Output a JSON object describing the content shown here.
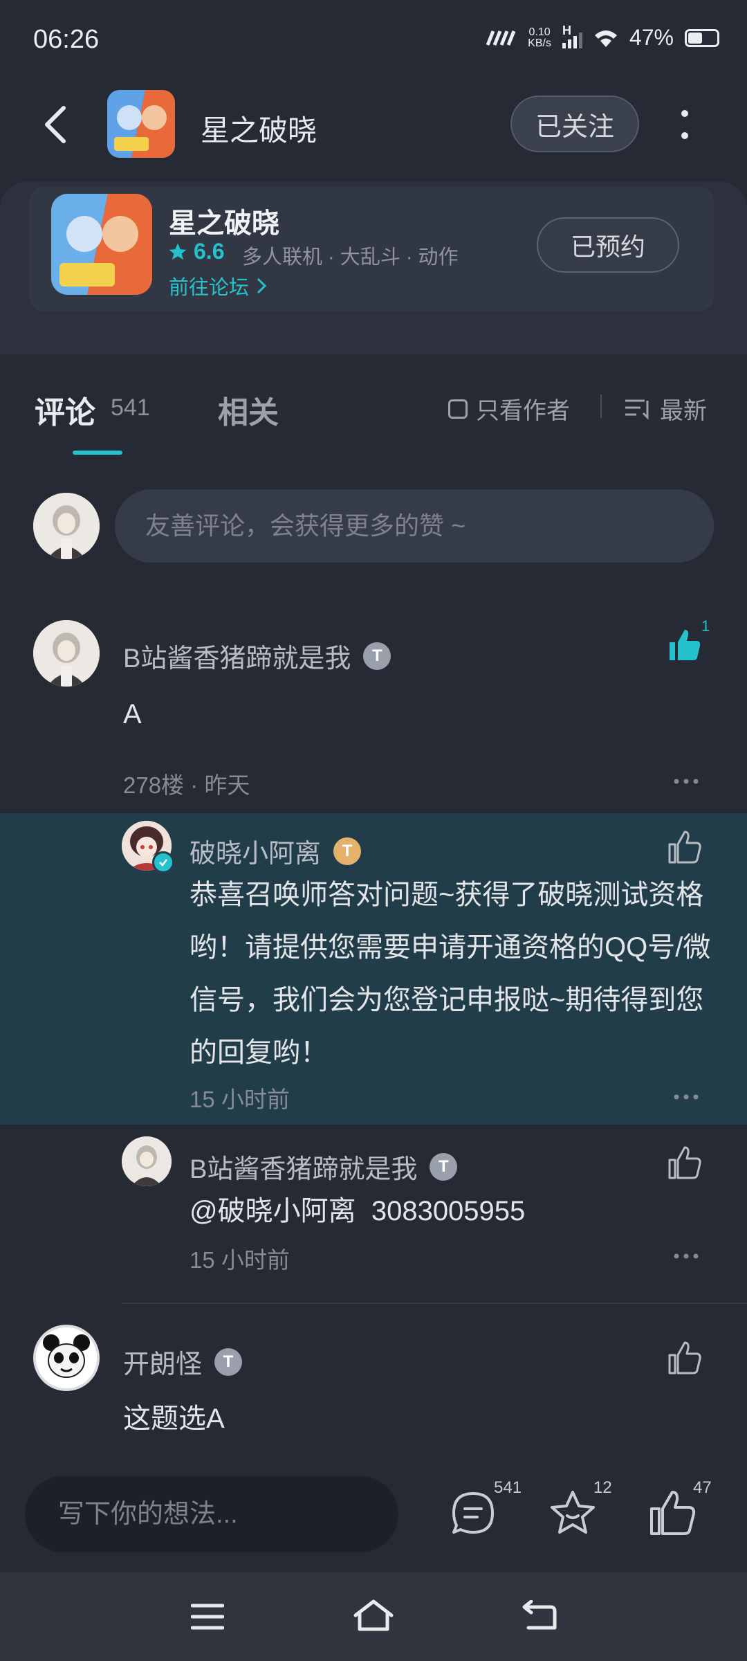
{
  "status_bar": {
    "time": "06:26",
    "net_speed_value": "0.10",
    "net_speed_unit": "KB/s",
    "signal_label": "H",
    "battery": "47%"
  },
  "header": {
    "title": "星之破晓",
    "follow_label": "已关注"
  },
  "game_card": {
    "title": "星之破晓",
    "rating": "6.6",
    "tags": "多人联机 · 大乱斗 · 动作",
    "forum_link": "前往论坛",
    "reserve_label": "已预约"
  },
  "tabs": {
    "comments_label": "评论",
    "comments_count": "541",
    "related_label": "相关",
    "only_author_label": "只看作者",
    "sort_label": "最新"
  },
  "comment_input": {
    "placeholder": "友善评论，会获得更多的赞 ~"
  },
  "comments": [
    {
      "user": "B站酱香猪蹄就是我",
      "text": "A",
      "floor_time": "278楼 · 昨天",
      "likes": "1",
      "replies": [
        {
          "user": "破晓小阿离",
          "text": "恭喜召唤师答对问题~获得了破晓测试资格哟！请提供您需要申请开通资格的QQ号/微信号，我们会为您登记申报哒~期待得到您的回复哟！",
          "time": "15 小时前"
        },
        {
          "user": "B站酱香猪蹄就是我",
          "text": "@破晓小阿离  3083005955",
          "time": "15 小时前"
        }
      ]
    },
    {
      "user": "开朗怪",
      "text": "这题选A"
    }
  ],
  "bottom_bar": {
    "placeholder": "写下你的想法...",
    "comment_count": "541",
    "favorite_count": "12",
    "like_count": "47"
  },
  "badge_letter": "T",
  "colors": {
    "accent": "#25c2ce",
    "background": "#262a35",
    "reply_highlight": "#223d4a"
  }
}
